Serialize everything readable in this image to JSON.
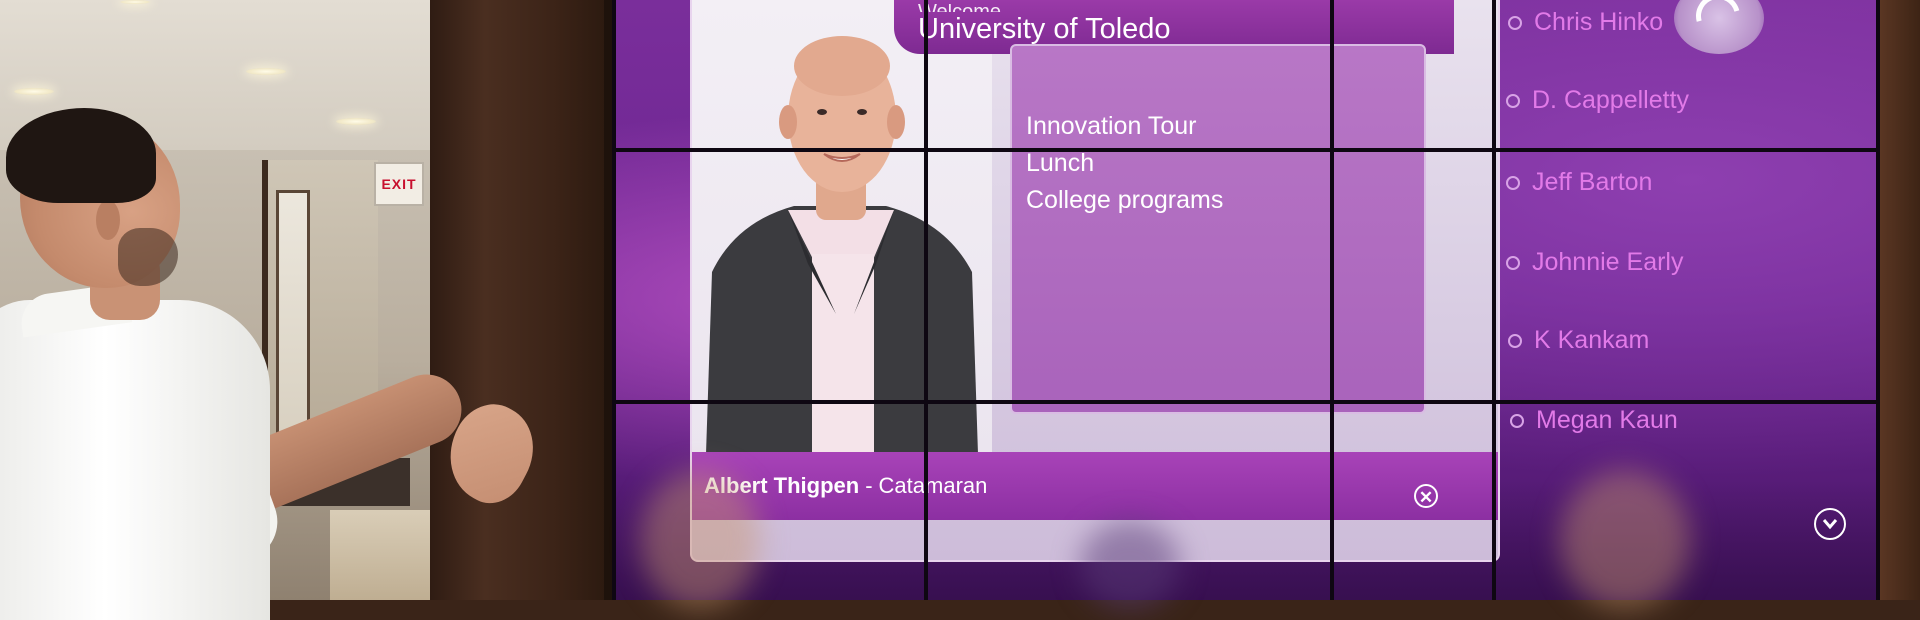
{
  "environment": {
    "exit_sign": "EXIT"
  },
  "wall": {
    "colors": {
      "accent": "#8c2fa2",
      "panel_bg": "#e3dbe9",
      "agenda_bg": "#b06ac1",
      "name_text": "#e27ae8",
      "text": "#ffffff"
    },
    "header": {
      "title": "University of Toledo"
    },
    "agenda": {
      "items": [
        "Innovation Tour",
        "Lunch",
        "College programs"
      ]
    },
    "presenter": {
      "name": "Albert Thigpen",
      "separator": "-",
      "company": "Catamaran"
    },
    "close_icon": "close-icon",
    "logo_icon": "logo-icon",
    "scroll_icon": "chevron-down-icon",
    "people": [
      {
        "name": "Chris Hinko"
      },
      {
        "name": "D. Cappelletty"
      },
      {
        "name": "Jeff Barton"
      },
      {
        "name": "Johnnie Early"
      },
      {
        "name": "K Kankam"
      },
      {
        "name": "Megan Kaun"
      }
    ]
  }
}
